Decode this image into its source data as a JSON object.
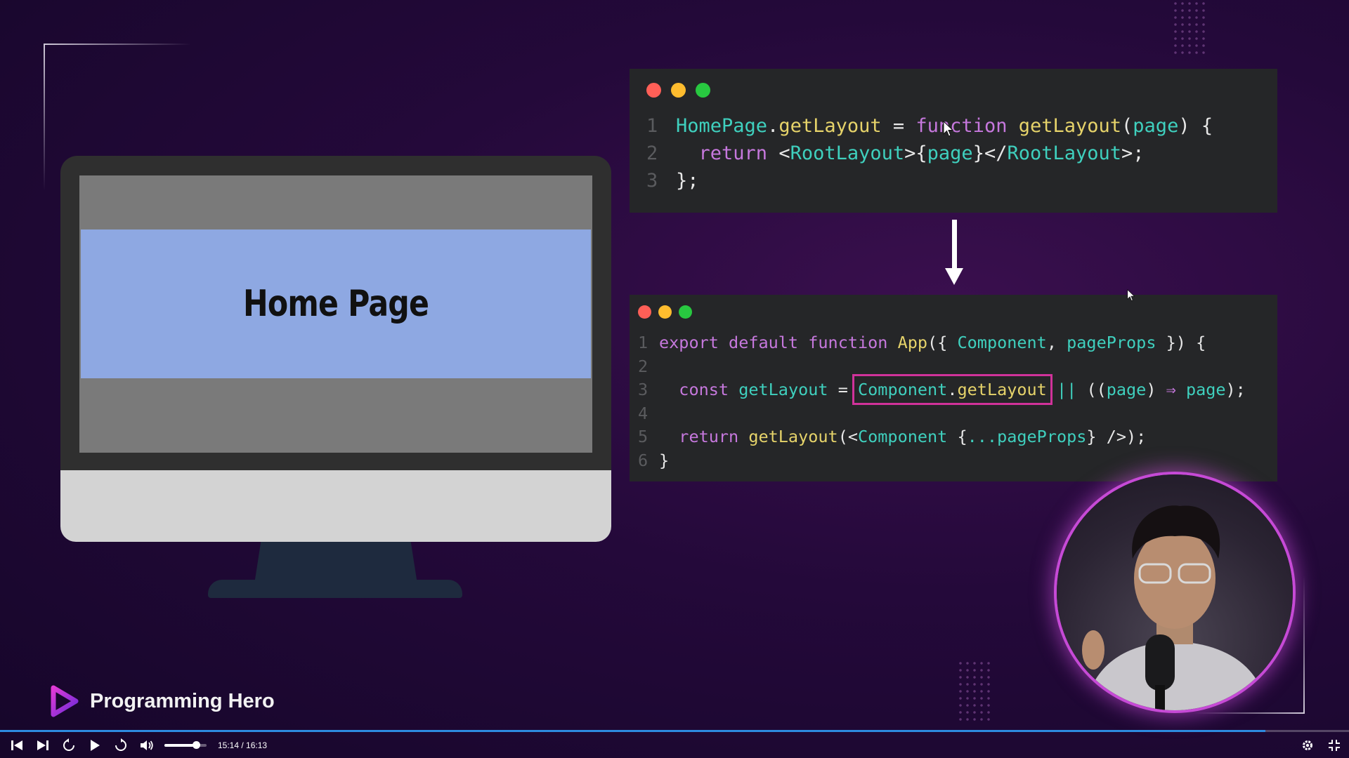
{
  "slide": {
    "monitor_title": "Home Page",
    "code1": {
      "line_numbers": [
        "1",
        "2",
        "3"
      ],
      "l1": {
        "a": "HomePage",
        "b": ".",
        "c": "getLayout",
        "d": " = ",
        "e": "function",
        "f": " ",
        "g": "getLayout",
        "h": "(",
        "i": "page",
        "j": ") {"
      },
      "l2": {
        "indent": "  ",
        "a": "return",
        "b": " <",
        "c": "RootLayout",
        "d": ">{",
        "e": "page",
        "f": "}</",
        "g": "RootLayout",
        "h": ">;"
      },
      "l3": {
        "a": "};"
      }
    },
    "code2": {
      "line_numbers": [
        "1",
        "2",
        "3",
        "4",
        "5",
        "6"
      ],
      "l1": {
        "a": "export",
        "b": " ",
        "c": "default",
        "d": " ",
        "e": "function",
        "f": " ",
        "g": "App",
        "h": "({ ",
        "i": "Component",
        "j": ", ",
        "k": "pageProps",
        "l": " }) {"
      },
      "l3": {
        "indent": "  ",
        "a": "const",
        "b": " ",
        "c": "getLayout",
        "d": " = ",
        "e": "Component",
        "f": ".",
        "g": "getLayout",
        "h": " || ",
        "i": "((",
        "j": "page",
        "k": ") ",
        "l": "⇒",
        "m": " ",
        "n": "page",
        "o": ");"
      },
      "l5": {
        "indent": "  ",
        "a": "return",
        "b": " ",
        "c": "getLayout",
        "d": "(<",
        "e": "Component",
        "f": " {",
        "g": "...",
        "h": "pageProps",
        "i": "} />);"
      },
      "l6": {
        "a": "}"
      }
    },
    "brand": "Programming Hero"
  },
  "player": {
    "current_time": "15:14",
    "separator": " / ",
    "duration": "16:13",
    "progress_fraction": 0.938,
    "volume_fraction": 0.75
  },
  "colors": {
    "accent": "#2d8be0",
    "highlight_box": "#d0329a"
  }
}
